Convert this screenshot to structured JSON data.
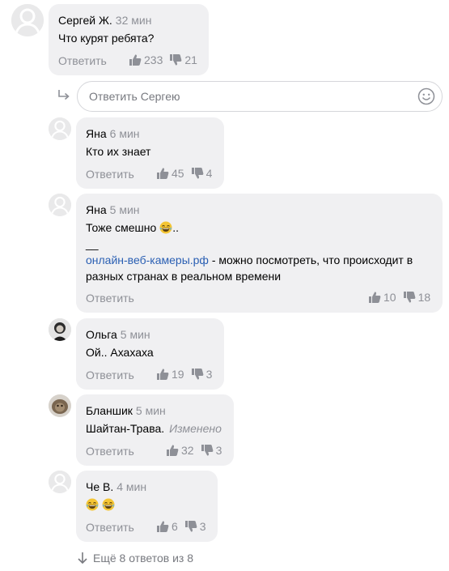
{
  "thread": {
    "reply_placeholder": "Ответить Сергею",
    "more_label": "Ещё 8 ответов из 8",
    "reply_label": "Ответить"
  },
  "comments": [
    {
      "author": "Сергей Ж.",
      "time": "32 мин",
      "text": "Что курят ребята?",
      "likes": "233",
      "dislikes": "21"
    },
    {
      "author": "Яна",
      "time": "6 мин",
      "text": "Кто их знает",
      "likes": "45",
      "dislikes": "4"
    },
    {
      "author": "Яна",
      "time": "5 мин",
      "text": "Тоже смешно",
      "text_suffix": "..",
      "separator": "__",
      "link": "онлайн-веб-камеры.рф",
      "link_rest": " - можно посмотреть, что происходит в",
      "line3": "разных странах в реальном времени",
      "likes": "10",
      "dislikes": "18"
    },
    {
      "author": "Ольга",
      "time": "5 мин",
      "text": "Ой.. Ахахаха",
      "likes": "19",
      "dislikes": "3"
    },
    {
      "author": "Бланшик",
      "time": "5 мин",
      "text": "Шайтан-Трава.",
      "edited": "Изменено",
      "likes": "32",
      "dislikes": "3"
    },
    {
      "author": "Че В.",
      "time": "4 мин",
      "likes": "6",
      "dislikes": "3"
    }
  ],
  "colors": {
    "bubble": "#f0f0f2",
    "muted": "#8e9097",
    "link": "#2a5fb3"
  },
  "icons": {
    "like": "thumb-up-icon",
    "dislike": "thumb-down-icon",
    "emoji": "laughing-emoji-icon",
    "smile": "smile-icon",
    "reply": "reply-arrow-icon",
    "more": "arrow-down-icon"
  }
}
